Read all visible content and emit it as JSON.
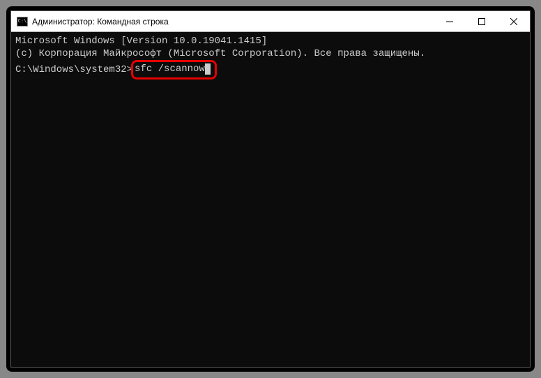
{
  "window": {
    "title": "Администратор: Командная строка",
    "icon_text": "C:\\"
  },
  "terminal": {
    "line1": "Microsoft Windows [Version 10.0.19041.1415]",
    "line2": "(c) Корпорация Майкрософт (Microsoft Corporation). Все права защищены.",
    "blank": "",
    "prompt": "C:\\Windows\\system32>",
    "command": "sfc /scannow"
  }
}
